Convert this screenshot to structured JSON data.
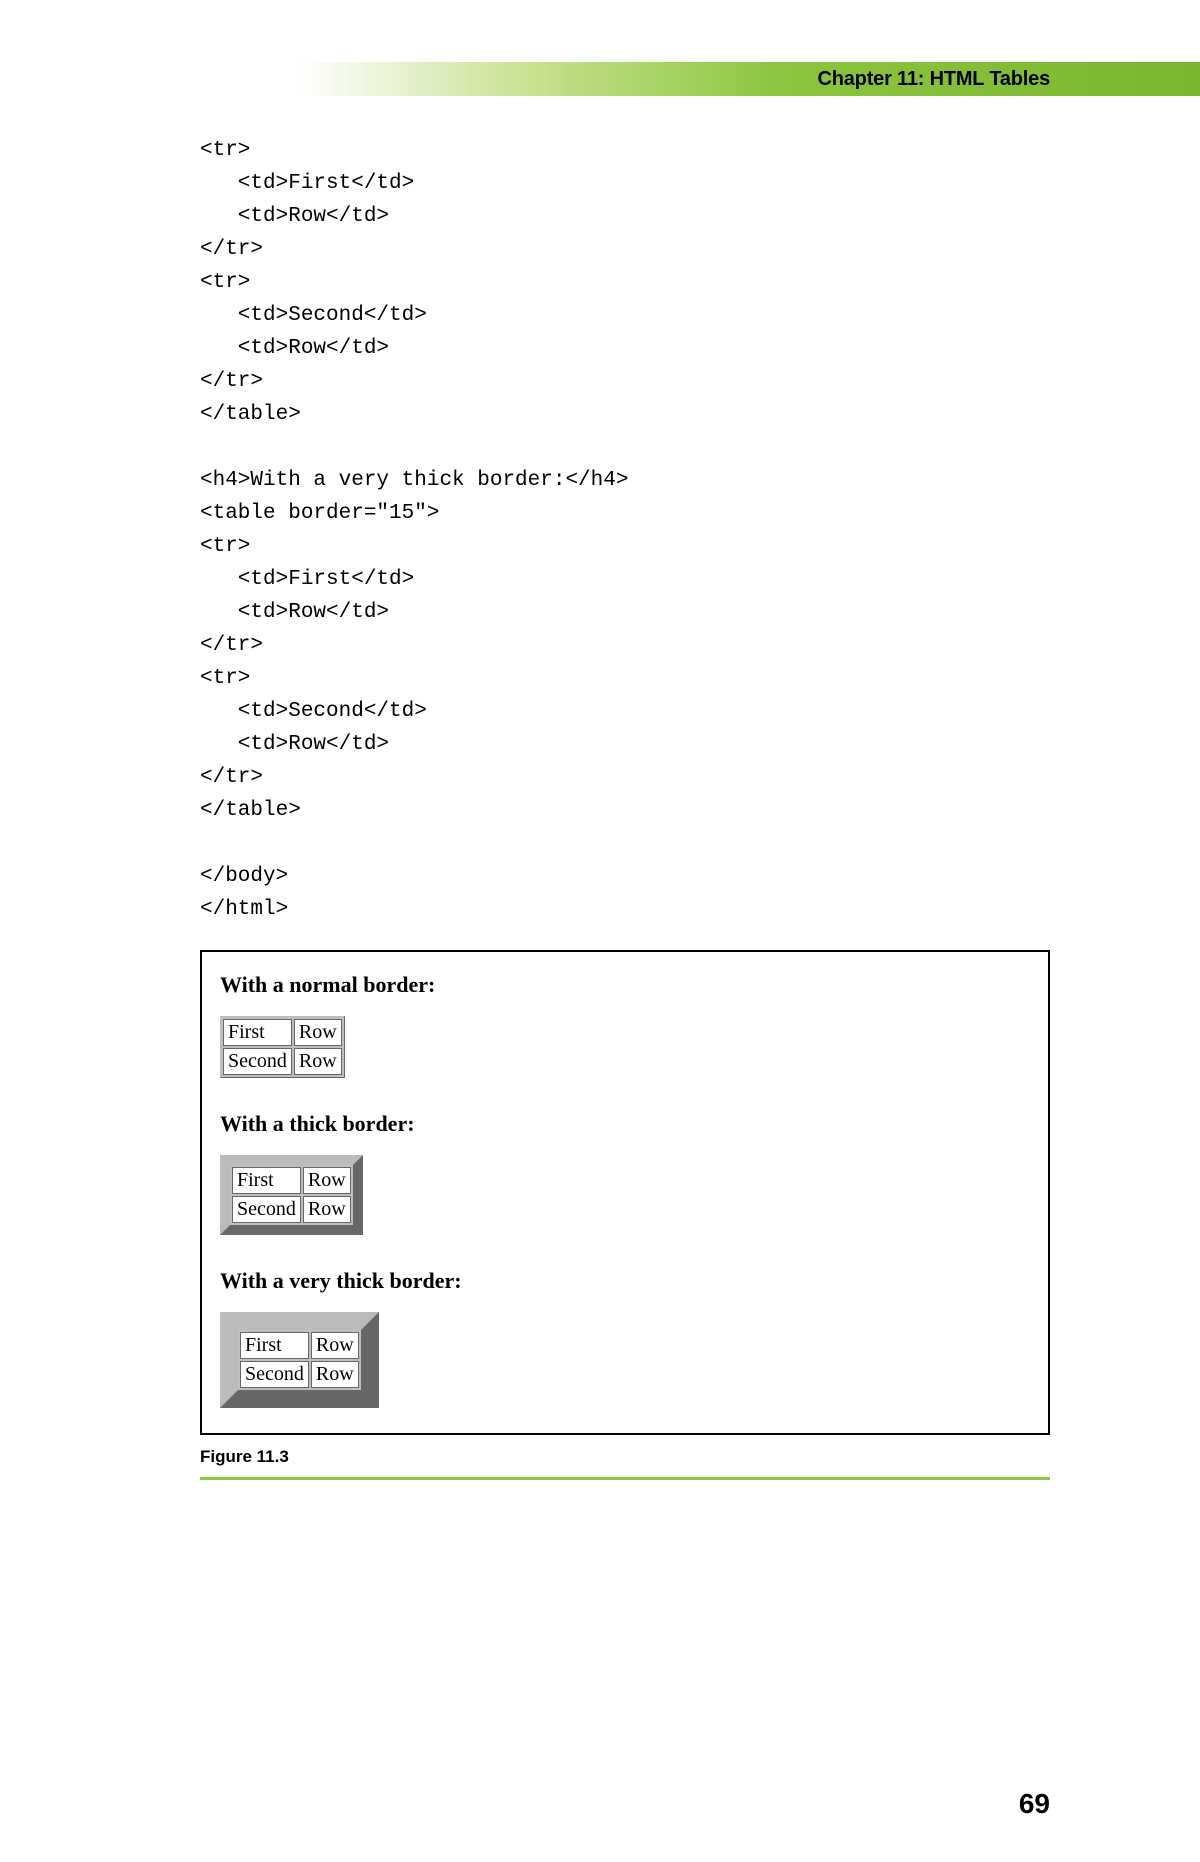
{
  "header": {
    "chapter_label": "Chapter 11: HTML Tables"
  },
  "code": {
    "lines": "<tr>\n   <td>First</td>\n   <td>Row</td>\n</tr>\n<tr>\n   <td>Second</td>\n   <td>Row</td>\n</tr>\n</table>\n\n<h4>With a very thick border:</h4>\n<table border=\"15\">\n<tr>\n   <td>First</td>\n   <td>Row</td>\n</tr>\n<tr>\n   <td>Second</td>\n   <td>Row</td>\n</tr>\n</table>\n\n</body>\n</html>"
  },
  "output": {
    "sections": [
      {
        "heading": "With a normal border:",
        "border": "1",
        "rows": [
          [
            "First",
            "Row"
          ],
          [
            "Second",
            "Row"
          ]
        ]
      },
      {
        "heading": "With a thick border:",
        "border": "8",
        "rows": [
          [
            "First",
            "Row"
          ],
          [
            "Second",
            "Row"
          ]
        ]
      },
      {
        "heading": "With a very thick border:",
        "border": "15",
        "rows": [
          [
            "First",
            "Row"
          ],
          [
            "Second",
            "Row"
          ]
        ]
      }
    ]
  },
  "figure_caption": "Figure 11.3",
  "page_number": "69"
}
